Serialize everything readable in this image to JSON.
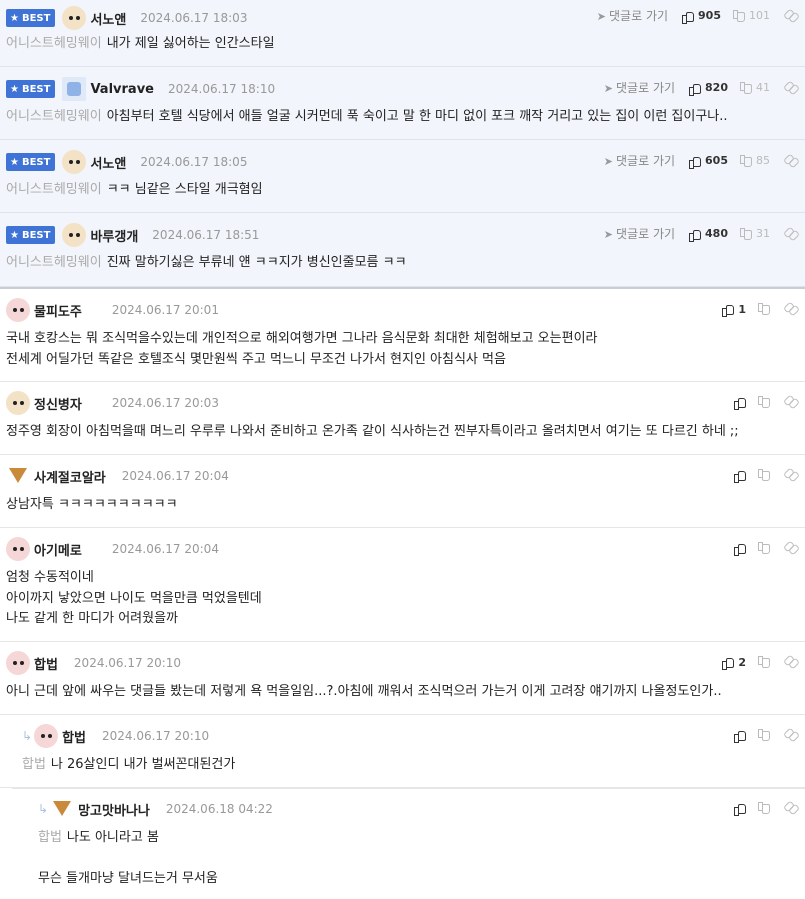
{
  "ui": {
    "best_label": "BEST",
    "goto_label": "댓글로 가기"
  },
  "best_comments": [
    {
      "nick": "서노앤",
      "date": "2024.06.17 18:03",
      "target": "어니스트헤밍웨이",
      "text": "내가 제일 싫어하는 인간스타일",
      "up": "905",
      "down": "101",
      "avatar": "puppy-icon"
    },
    {
      "nick": "Valvrave",
      "date": "2024.06.17 18:10",
      "target": "어니스트헤밍웨이",
      "text": "아침부터 호텔 식당에서 애들 얼굴 시커먼데 푹 숙이고 말 한 마디 없이 포크 깨작 거리고 있는 집이 이런 집이구나..",
      "up": "820",
      "down": "41",
      "avatar": "robot-icon"
    },
    {
      "nick": "서노앤",
      "date": "2024.06.17 18:05",
      "target": "어니스트헤밍웨이",
      "text": "ㅋㅋ 님같은 스타일 개극혐임",
      "up": "605",
      "down": "85",
      "avatar": "puppy-icon"
    },
    {
      "nick": "바루갱개",
      "date": "2024.06.17 18:51",
      "target": "어니스트헤밍웨이",
      "text": "진짜 말하기싫은 부류네 얜 ㅋㅋ지가 병신인줄모름 ㅋㅋ",
      "up": "480",
      "down": "31",
      "avatar": "puppy-icon"
    }
  ],
  "comments": [
    {
      "nick": "물피도주",
      "date": "2024.06.17 20:01",
      "lines": [
        "국내 호캉스는 뭐 조식먹을수있는데 개인적으로 해외여행가면 그나라 음식문화 최대한 체험해보고 오는편이라",
        "전세계 어딜가던 똑같은 호텔조식 몇만원씩 주고 먹느니 무조건 나가서 현지인 아침식사 먹음"
      ],
      "up": "1",
      "avatar": "face-icon"
    },
    {
      "nick": "정신병자",
      "date": "2024.06.17 20:03",
      "lines": [
        "정주영 회장이 아침먹을때 며느리 우루루 나와서 준비하고 온가족 같이 식사하는건 찐부자특이라고 올려치면서 여기는 또 다르긴 하네 ;;"
      ],
      "up": "",
      "avatar": "puppy-icon"
    },
    {
      "nick": "사계절코알라",
      "date": "2024.06.17 20:04",
      "lines": [
        "상남자특 ㅋㅋㅋㅋㅋㅋㅋㅋㅋㅋ"
      ],
      "up": "",
      "avatar": "fox-icon"
    },
    {
      "nick": "아기메로",
      "date": "2024.06.17 20:04",
      "lines": [
        "엄청 수동적이네",
        "아이까지 낳았으면 나이도 먹을만큼 먹었을텐데",
        "나도 같게 한 마디가 어려웠을까"
      ],
      "up": "",
      "avatar": "face-icon"
    },
    {
      "nick": "합법",
      "date": "2024.06.17 20:10",
      "lines": [
        "아니 근데 앞에 싸우는 댓글들 봤는데 저렇게 욕 먹을일임...?.아침에 깨워서 조식먹으러 가는거 이게 고려장 얘기까지 나올정도인가.."
      ],
      "up": "2",
      "avatar": "face-icon"
    }
  ],
  "replies": [
    {
      "nick": "합법",
      "date": "2024.06.17 20:10",
      "target": "합법",
      "lines": [
        "나 26살인디 내가 벌써꼰대된건가"
      ],
      "avatar": "face-icon"
    },
    {
      "nick": "망고맛바나나",
      "date": "2024.06.18 04:22",
      "target": "합법",
      "lines": [
        "나도 아니라고 봄",
        "",
        "무슨 들개마냥 달녀드는거 무서움"
      ],
      "avatar": "fox-icon"
    }
  ]
}
